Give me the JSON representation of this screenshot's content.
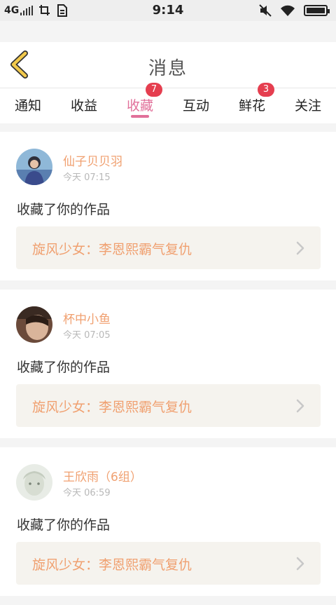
{
  "status_bar": {
    "network": "4G",
    "time": "9:14",
    "icons": [
      "signal-icon",
      "screenshot-icon",
      "sim-icon",
      "mute-icon",
      "wifi-icon",
      "battery-icon"
    ]
  },
  "header": {
    "title": "消息",
    "back_icon": "chevron-left-icon"
  },
  "tabs": [
    {
      "label": "通知",
      "badge": null,
      "active": false
    },
    {
      "label": "收益",
      "badge": null,
      "active": false
    },
    {
      "label": "收藏",
      "badge": "7",
      "active": true
    },
    {
      "label": "互动",
      "badge": null,
      "active": false
    },
    {
      "label": "鲜花",
      "badge": "3",
      "active": false
    },
    {
      "label": "关注",
      "badge": null,
      "active": false
    }
  ],
  "messages": [
    {
      "user": "仙子贝贝羽",
      "time": "今天 07:15",
      "action": "收藏了你的作品",
      "work": "旋风少女：李恩熙霸气复仇"
    },
    {
      "user": "杯中小鱼",
      "time": "今天 07:05",
      "action": "收藏了你的作品",
      "work": "旋风少女：李恩熙霸气复仇"
    },
    {
      "user": "王欣雨（6组）",
      "time": "今天 06:59",
      "action": "收藏了你的作品",
      "work": "旋风少女：李恩熙霸气复仇"
    }
  ],
  "colors": {
    "accent": "#e1709a",
    "username": "#f0a070",
    "badge": "#e53e4f",
    "back_icon": "#f2c94c"
  }
}
